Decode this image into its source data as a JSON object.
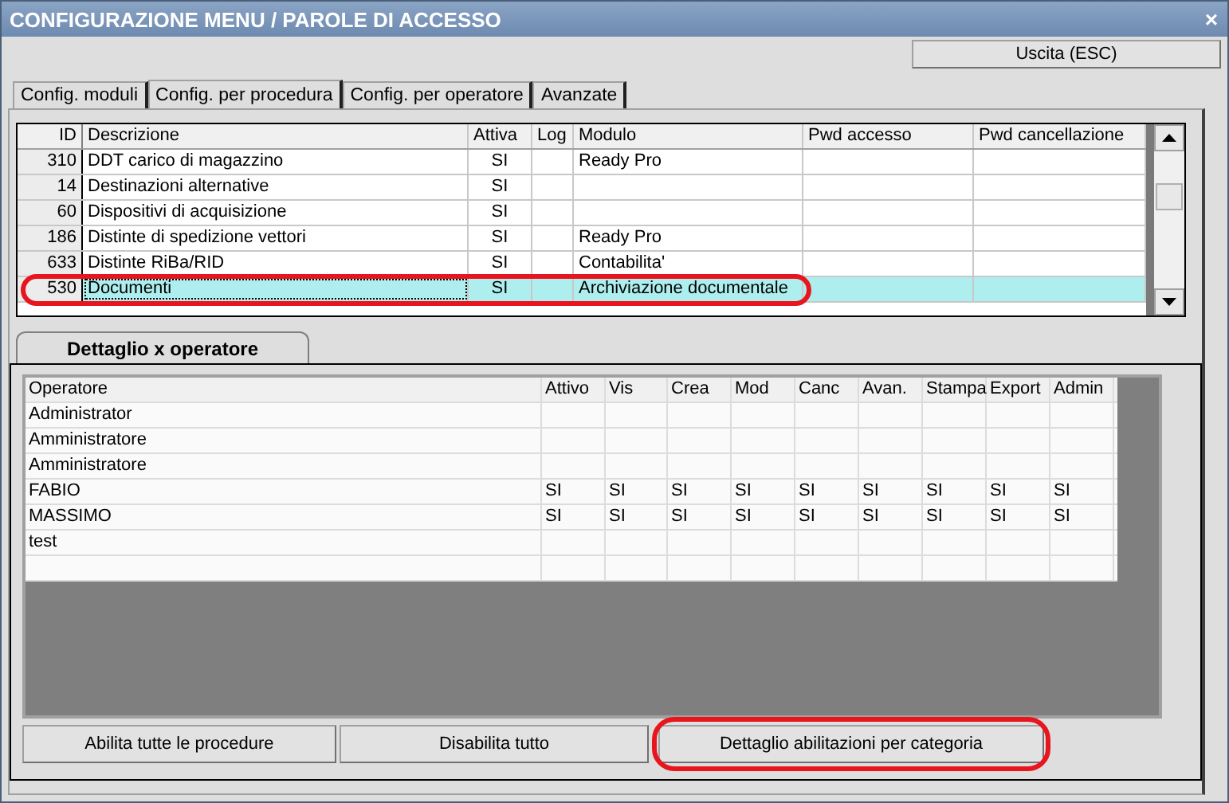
{
  "window": {
    "title": "CONFIGURAZIONE MENU / PAROLE DI ACCESSO",
    "close": "×"
  },
  "exit_button": "Uscita (ESC)",
  "tabs": [
    {
      "label": "Config. moduli",
      "selected": false
    },
    {
      "label": "Config. per procedura",
      "selected": true
    },
    {
      "label": "Config. per operatore",
      "selected": false
    },
    {
      "label": "Avanzate",
      "selected": false
    }
  ],
  "procedures": {
    "columns": [
      "ID",
      "Descrizione",
      "Attiva",
      "Log",
      "Modulo",
      "Pwd accesso",
      "Pwd cancellazione"
    ],
    "rows": [
      {
        "cells": [
          "310",
          "DDT carico di magazzino",
          "SI",
          "",
          "Ready Pro",
          "",
          ""
        ],
        "selected": false,
        "highlighted": false
      },
      {
        "cells": [
          "14",
          "Destinazioni alternative",
          "SI",
          "",
          "",
          "",
          ""
        ],
        "selected": false,
        "highlighted": false
      },
      {
        "cells": [
          "60",
          "Dispositivi di acquisizione",
          "SI",
          "",
          "",
          "",
          ""
        ],
        "selected": false,
        "highlighted": false
      },
      {
        "cells": [
          "186",
          "Distinte di spedizione vettori",
          "SI",
          "",
          "Ready Pro",
          "",
          ""
        ],
        "selected": false,
        "highlighted": false
      },
      {
        "cells": [
          "633",
          "Distinte RiBa/RID",
          "SI",
          "",
          "Contabilita'",
          "",
          ""
        ],
        "selected": false,
        "highlighted": false
      },
      {
        "cells": [
          "530",
          "Documenti",
          "SI",
          "",
          "Archiviazione documentale",
          "",
          ""
        ],
        "selected": true,
        "highlighted": true
      }
    ]
  },
  "detail_tab": {
    "label": "Dettaglio x operatore",
    "selected": true
  },
  "operators": {
    "columns": [
      "Operatore",
      "Attivo",
      "Vis",
      "Crea",
      "Mod",
      "Canc",
      "Avan.",
      "Stampa",
      "Export",
      "Admin"
    ],
    "rows": [
      [
        "Administrator",
        "",
        "",
        "",
        "",
        "",
        "",
        "",
        "",
        ""
      ],
      [
        "Amministratore",
        "",
        "",
        "",
        "",
        "",
        "",
        "",
        "",
        ""
      ],
      [
        "Amministratore",
        "",
        "",
        "",
        "",
        "",
        "",
        "",
        "",
        ""
      ],
      [
        "FABIO",
        "SI",
        "SI",
        "SI",
        "SI",
        "SI",
        "SI",
        "SI",
        "SI",
        "SI"
      ],
      [
        "MASSIMO",
        "SI",
        "SI",
        "SI",
        "SI",
        "SI",
        "SI",
        "SI",
        "SI",
        "SI"
      ],
      [
        "test",
        "",
        "",
        "",
        "",
        "",
        "",
        "",
        "",
        ""
      ],
      [
        "",
        "",
        "",
        "",
        "",
        "",
        "",
        "",
        "",
        ""
      ]
    ]
  },
  "buttons": [
    {
      "label": "Abilita tutte le procedure",
      "highlighted": false
    },
    {
      "label": "Disabilita tutto",
      "highlighted": false
    },
    {
      "label": "Dettaglio abilitazioni per categoria",
      "highlighted": true
    }
  ]
}
